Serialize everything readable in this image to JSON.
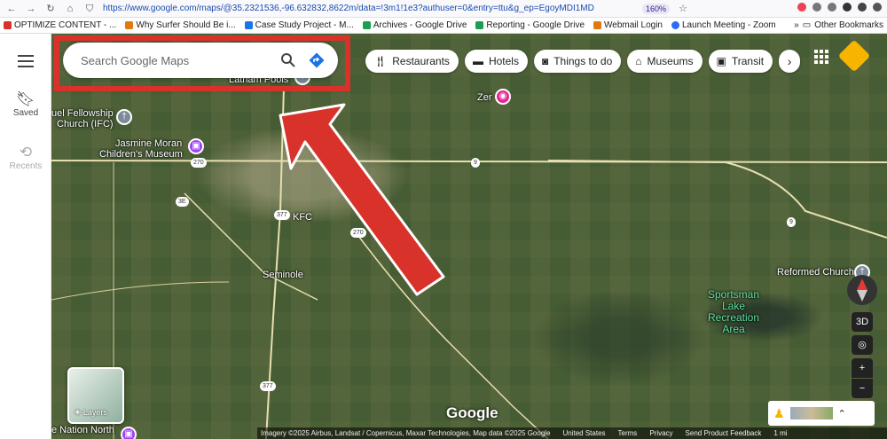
{
  "browser": {
    "url": "https://www.google.com/maps/@35.2321536,-96.632832,8622m/data=!3m1!1e3?authuser=0&entry=ttu&g_ep=EgoyMDI1MD",
    "zoom": "160%",
    "bookmarks": [
      {
        "label": "OPTIMIZE CONTENT - ...",
        "color": "#d9322a"
      },
      {
        "label": "Why Surfer Should Be i...",
        "color": "#e07a10"
      },
      {
        "label": "Case Study Project - M...",
        "color": "#1a73e8"
      },
      {
        "label": "Archives - Google Drive",
        "color": "#1a9e4f"
      },
      {
        "label": "Reporting - Google Drive",
        "color": "#1a9e4f"
      },
      {
        "label": "Webmail Login",
        "color": "#e07a10"
      },
      {
        "label": "Launch Meeting - Zoom",
        "color": "#2d6cf2"
      }
    ],
    "other_bookmarks": "Other Bookmarks"
  },
  "rail": {
    "saved": "Saved",
    "recents": "Recents"
  },
  "search": {
    "placeholder": "Search Google Maps"
  },
  "chips": [
    {
      "label": "Restaurants",
      "icon": "fork-knife-icon"
    },
    {
      "label": "Hotels",
      "icon": "bed-icon"
    },
    {
      "label": "Things to do",
      "icon": "camera-icon"
    },
    {
      "label": "Museums",
      "icon": "museum-icon"
    },
    {
      "label": "Transit",
      "icon": "train-icon"
    }
  ],
  "map": {
    "labels": {
      "latham_pools": "Latham Pools",
      "fellowship": "uel Fellowship",
      "fellowship2": "Church (IFC)",
      "jasmine": "Jasmine Moran",
      "jasmine2": "Children's Museum",
      "kfc": "KFC",
      "seminole": "Seminole",
      "zer": "Zer",
      "reformed": "Reformed Church",
      "sportsman1": "Sportsman",
      "sportsman2": "Lake",
      "sportsman3": "Recreation",
      "sportsman4": "Area",
      "nation": "e Nation North"
    },
    "shields": {
      "r270a": "270",
      "r3e": "3E",
      "r377a": "377",
      "r270b": "270",
      "r9a": "9",
      "r9b": "9",
      "r377b": "377"
    }
  },
  "controls": {
    "three_d": "3D",
    "zoom_in": "+",
    "zoom_out": "−"
  },
  "layers": {
    "label": "Layers"
  },
  "logo": "Google",
  "scale": "1 mi",
  "attribution": {
    "imagery": "Imagery ©2025 Airbus, Landsat / Copernicus, Maxar Technologies, Map data ©2025 Google",
    "country": "United States",
    "terms": "Terms",
    "privacy": "Privacy",
    "feedback": "Send Product Feedback"
  },
  "colors": {
    "highlight": "#d9322a",
    "arrow": "#d9322a",
    "pin_purple": "#a142f4",
    "pin_pink": "#e52592",
    "pin_gray": "#7d8a97"
  }
}
